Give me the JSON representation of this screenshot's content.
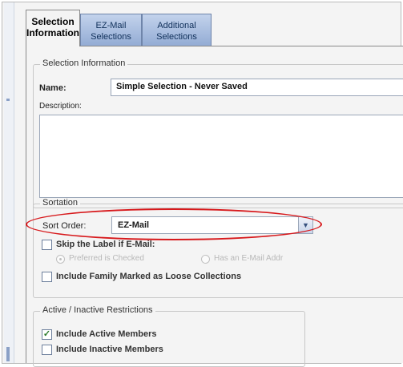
{
  "tabs": [
    {
      "line1": "Selection",
      "line2": "Information"
    },
    {
      "line1": "EZ-Mail",
      "line2": "Selections"
    },
    {
      "line1": "Additional",
      "line2": "Selections"
    }
  ],
  "selection_info": {
    "legend": "Selection Information",
    "name_label": "Name:",
    "name_value": "Simple Selection - Never Saved",
    "description_label": "Description:"
  },
  "sortation": {
    "legend": "Sortation",
    "sort_order_label": "Sort Order:",
    "sort_order_value": "EZ-Mail",
    "skip_label": "Skip the Label if E-Mail:",
    "radio_preferred": "Preferred is Checked",
    "radio_has_email": "Has an E-Mail Addr",
    "include_family": "Include Family Marked as Loose Collections"
  },
  "restrictions": {
    "legend": "Active / Inactive Restrictions",
    "include_active": "Include Active Members",
    "include_active_checked": true,
    "include_inactive": "Include Inactive Members",
    "include_inactive_checked": false
  },
  "colors": {
    "highlight": "#d7191c",
    "tab_fill": "#93acd4"
  }
}
